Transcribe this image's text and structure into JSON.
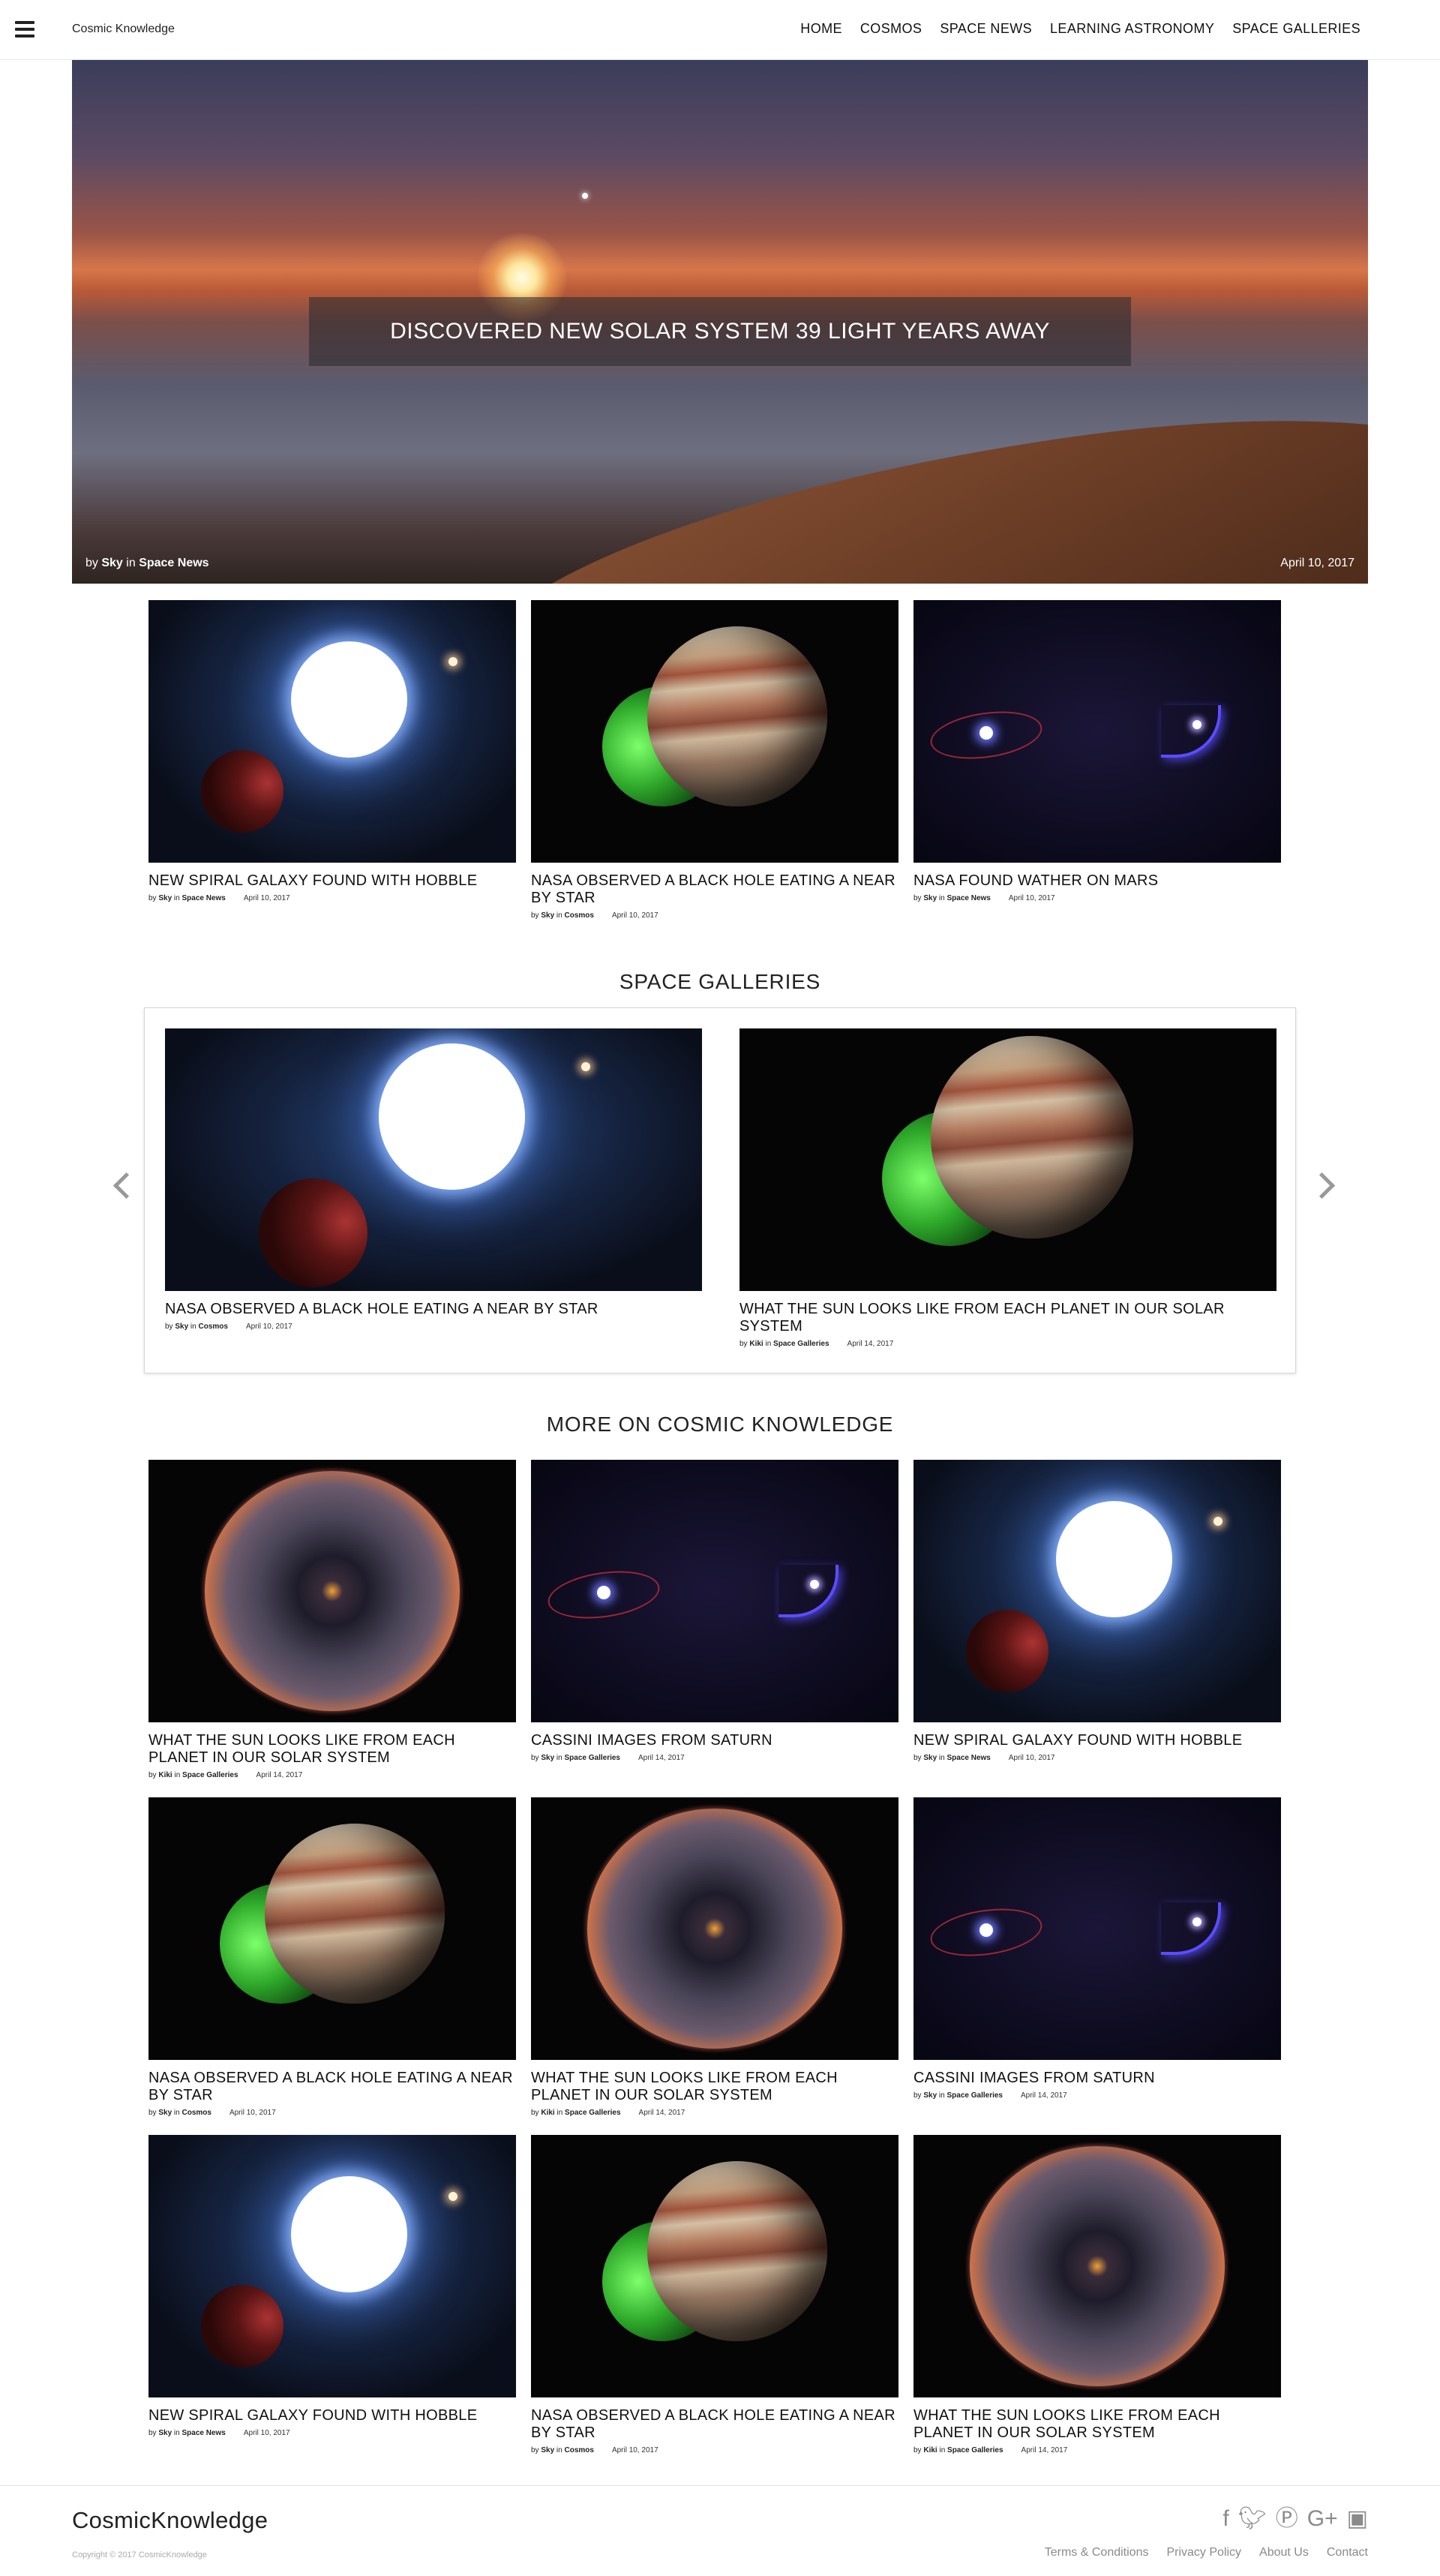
{
  "header": {
    "brand": "Cosmic Knowledge",
    "nav": [
      "HOME",
      "COSMOS",
      "SPACE NEWS",
      "LEARNING ASTRONOMY",
      "SPACE GALLERIES"
    ]
  },
  "hero": {
    "title": "DISCOVERED NEW SOLAR SYSTEM 39 LIGHT YEARS AWAY",
    "by": "by",
    "author": "Sky",
    "in": "in",
    "category": "Space News",
    "date": "April 10, 2017"
  },
  "featured": [
    {
      "title": "NEW SPIRAL GALAXY FOUND WITH HOBBLE",
      "author": "Sky",
      "category": "Space News",
      "date": "April 10, 2017"
    },
    {
      "title": "NASA OBSERVED A BLACK HOLE EATING A NEAR BY STAR",
      "author": "Sky",
      "category": "Cosmos",
      "date": "April 10, 2017"
    },
    {
      "title": "NASA FOUND WATHER ON MARS",
      "author": "Sky",
      "category": "Space News",
      "date": "April 10, 2017"
    }
  ],
  "galleries": {
    "heading": "SPACE GALLERIES",
    "items": [
      {
        "title": "NASA OBSERVED A BLACK HOLE EATING A NEAR BY STAR",
        "author": "Sky",
        "category": "Cosmos",
        "date": "April 10, 2017"
      },
      {
        "title": "WHAT THE SUN LOOKS LIKE FROM EACH PLANET IN OUR SOLAR SYSTEM",
        "author": "Kiki",
        "category": "Space Galleries",
        "date": "April 14, 2017"
      }
    ]
  },
  "more": {
    "heading": "MORE ON COSMIC KNOWLEDGE",
    "items": [
      {
        "title": "WHAT THE SUN LOOKS LIKE FROM EACH PLANET IN OUR SOLAR SYSTEM",
        "author": "Kiki",
        "category": "Space Galleries",
        "date": "April 14, 2017"
      },
      {
        "title": "CASSINI IMAGES FROM SATURN",
        "author": "Sky",
        "category": "Space Galleries",
        "date": "April 14, 2017"
      },
      {
        "title": "NEW SPIRAL GALAXY FOUND WITH HOBBLE",
        "author": "Sky",
        "category": "Space News",
        "date": "April 10, 2017"
      },
      {
        "title": "NASA OBSERVED A BLACK HOLE EATING A NEAR BY STAR",
        "author": "Sky",
        "category": "Cosmos",
        "date": "April 10, 2017"
      },
      {
        "title": "WHAT THE SUN LOOKS LIKE FROM EACH PLANET IN OUR SOLAR SYSTEM",
        "author": "Kiki",
        "category": "Space Galleries",
        "date": "April 14, 2017"
      },
      {
        "title": "CASSINI IMAGES FROM SATURN",
        "author": "Sky",
        "category": "Space Galleries",
        "date": "April 14, 2017"
      },
      {
        "title": "NEW SPIRAL GALAXY FOUND WITH HOBBLE",
        "author": "Sky",
        "category": "Space News",
        "date": "April 10, 2017"
      },
      {
        "title": "NASA OBSERVED A BLACK HOLE EATING A NEAR BY STAR",
        "author": "Sky",
        "category": "Cosmos",
        "date": "April 10, 2017"
      },
      {
        "title": "WHAT THE SUN LOOKS LIKE FROM EACH PLANET IN OUR SOLAR SYSTEM",
        "author": "Kiki",
        "category": "Space Galleries",
        "date": "April 14, 2017"
      }
    ]
  },
  "meta_words": {
    "by": "by",
    "in": "in"
  },
  "footer": {
    "logo": "CosmicKnowledge",
    "copyright": "Copyright © 2017 CosmicKnowledge",
    "social": [
      "facebook-icon",
      "twitter-icon",
      "pinterest-icon",
      "google-plus-icon",
      "instagram-icon"
    ],
    "links": [
      "Terms & Conditions",
      "Privacy Policy",
      "About Us",
      "Contact"
    ]
  }
}
